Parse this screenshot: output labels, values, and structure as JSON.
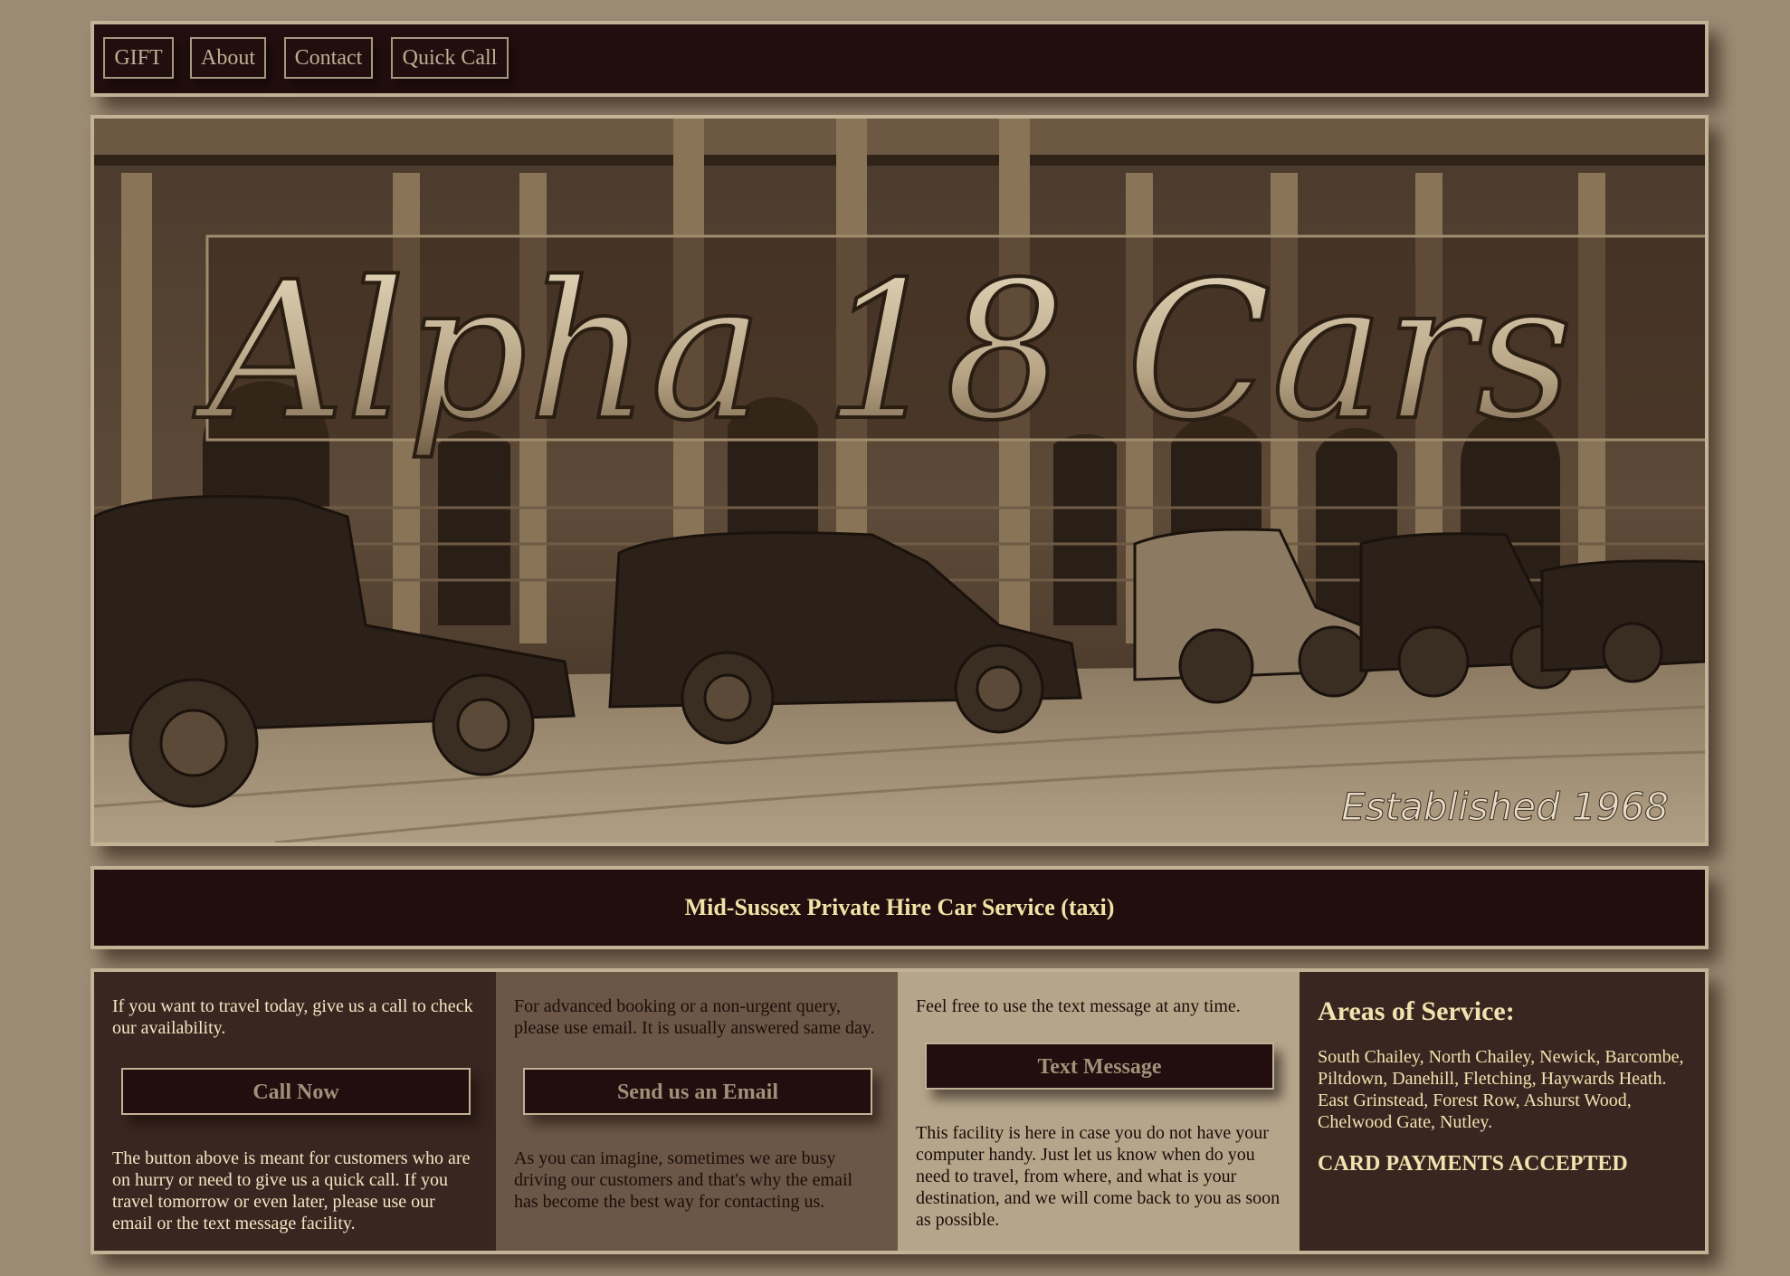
{
  "nav": {
    "items": [
      {
        "label": "GIFT"
      },
      {
        "label": "About"
      },
      {
        "label": "Contact"
      },
      {
        "label": "Quick Call"
      }
    ]
  },
  "hero": {
    "title": "Alpha 18 Cars",
    "established": "Established 1968"
  },
  "tagline": "Mid-Sussex Private Hire Car Service (taxi)",
  "info": {
    "call": {
      "intro": "If you want to travel today, give us a call to check our availability.",
      "button": "Call Now",
      "note": "The button above is meant for customers who are on hurry or need to give us a quick call. If you travel tomorrow or even later, please use our email or the text message facility."
    },
    "email": {
      "intro": "For advanced booking or a non-urgent query, please use email. It is usually answered same day.",
      "button": "Send us an Email",
      "note": "As you can imagine, sometimes we are busy driving our customers and that's why the email has become the best way for contacting us."
    },
    "text": {
      "intro": "Feel free to use the text message at any time.",
      "button": "Text Message",
      "note": "This facility is here in case you do not have your computer handy. Just let us know when do you need to travel, from where, and what is your destination, and we will come back to you as soon as possible."
    },
    "areas": {
      "heading": "Areas of Service:",
      "list": "South Chailey, North Chailey, Newick, Barcombe, Piltdown, Danehill, Fletching, Haywards Heath. East Grinstead, Forest Row, Ashurst Wood, Chelwood Gate, Nutley.",
      "payments": "CARD PAYMENTS ACCEPTED"
    }
  }
}
